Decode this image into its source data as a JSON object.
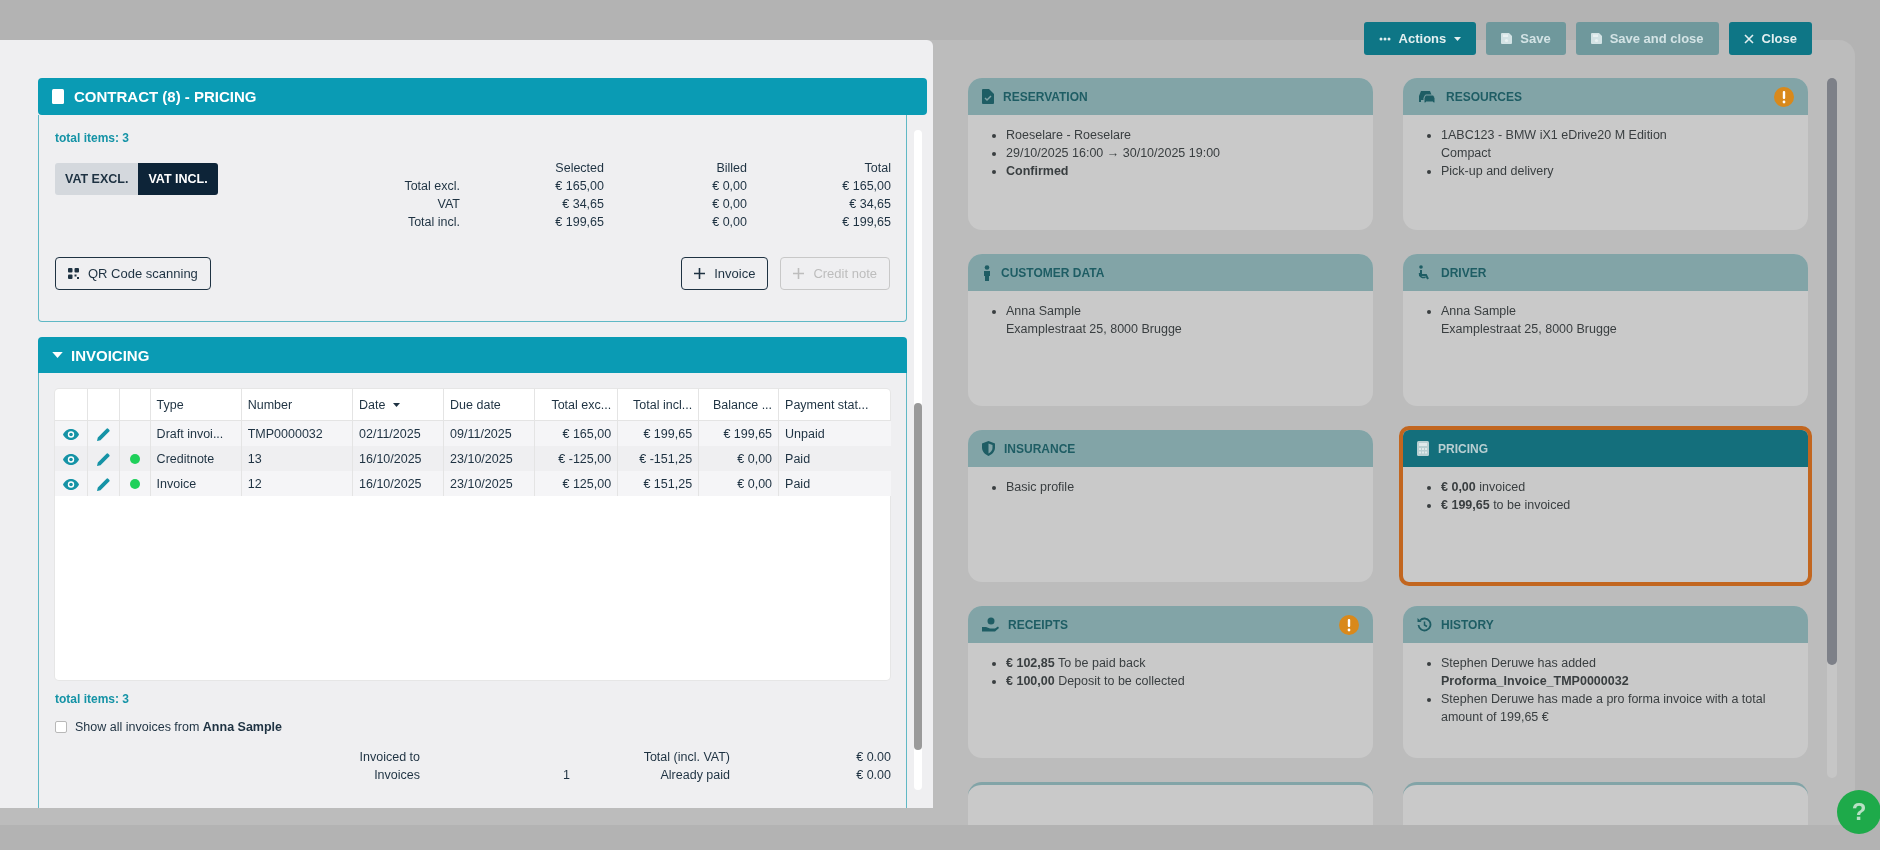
{
  "toolbar": {
    "buttons": [
      {
        "label": "Actions",
        "kind": "menu",
        "disabled": false
      },
      {
        "label": "Save",
        "kind": "save",
        "disabled": true
      },
      {
        "label": "Save and close",
        "kind": "save",
        "disabled": true
      },
      {
        "label": "Close",
        "kind": "close",
        "disabled": false
      }
    ]
  },
  "cards": [
    {
      "title": "RESERVATION",
      "alert": false,
      "highlighted": false,
      "items": [
        "Roeselare - Roeselare",
        "29/10/2025 16:00 → 30/10/2025 19:00",
        "**Confirmed**"
      ]
    },
    {
      "title": "RESOURCES",
      "alert": true,
      "highlighted": false,
      "items": [
        "1ABC123 - BMW iX1 eDrive20 M Edition\nCompact",
        "Pick-up and delivery"
      ]
    },
    {
      "title": "CUSTOMER DATA",
      "alert": false,
      "highlighted": false,
      "items": [
        "Anna Sample\nExamplestraat 25, 8000 Brugge"
      ]
    },
    {
      "title": "DRIVER",
      "alert": false,
      "highlighted": false,
      "items": [
        "Anna Sample\nExamplestraat 25, 8000 Brugge"
      ]
    },
    {
      "title": "INSURANCE",
      "alert": false,
      "highlighted": false,
      "items": [
        "Basic profile"
      ]
    },
    {
      "title": "PRICING",
      "alert": false,
      "highlighted": true,
      "items": [
        "**€ 0,00** invoiced",
        "**€ 199,65** to be invoiced"
      ]
    },
    {
      "title": "RECEIPTS",
      "alert": true,
      "highlighted": false,
      "items": [
        "**€ 102,85** To be paid back",
        "**€ 100,00** Deposit to be collected"
      ]
    },
    {
      "title": "HISTORY",
      "alert": false,
      "highlighted": false,
      "items": [
        "Stephen Deruwe has added\n**Proforma_Invoice_TMP0000032**",
        "Stephen Deruwe has made a pro forma invoice with a total amount of 199,65 €"
      ]
    }
  ],
  "modal": {
    "title": "CONTRACT (8) - PRICING",
    "pricing": {
      "total_items": "total items: 3",
      "vat_toggle": [
        {
          "label": "VAT EXCL.",
          "selected": false
        },
        {
          "label": "VAT INCL.",
          "selected": true
        }
      ],
      "summary": {
        "columns": [
          "Selected",
          "Billed",
          "Total"
        ],
        "rows": [
          {
            "label": "Total excl.",
            "values": [
              "€ 165,00",
              "€ 0,00",
              "€ 165,00"
            ]
          },
          {
            "label": "VAT",
            "values": [
              "€ 34,65",
              "€ 0,00",
              "€ 34,65"
            ]
          },
          {
            "label": "Total incl.",
            "values": [
              "€ 199,65",
              "€ 0,00",
              "€ 199,65"
            ]
          }
        ]
      },
      "buttons": [
        {
          "label": "QR Code scanning",
          "kind": "qr",
          "disabled": false
        },
        {
          "label": "Invoice",
          "kind": "add",
          "disabled": false
        },
        {
          "label": "Credit note",
          "kind": "add",
          "disabled": true
        }
      ]
    },
    "invoicing": {
      "title": "INVOICING",
      "expanded": true,
      "table": {
        "columns": [
          {
            "label": "Type",
            "sorted": false
          },
          {
            "label": "Number",
            "sorted": false
          },
          {
            "label": "Date",
            "sorted": true
          },
          {
            "label": "Due date",
            "sorted": false
          },
          {
            "label": "Total exc...",
            "sorted": false
          },
          {
            "label": "Total incl...",
            "sorted": false
          },
          {
            "label": "Balance ...",
            "sorted": false
          },
          {
            "label": "Payment stat...",
            "sorted": false
          }
        ],
        "rows": [
          {
            "cells": [
              "Draft invoi...",
              "TMP0000032",
              "02/11/2025",
              "09/11/2025",
              "€ 165,00",
              "€ 199,65",
              "€ 199,65",
              "Unpaid"
            ]
          },
          {
            "color": "#1fd05a",
            "cells": [
              "Creditnote",
              "13",
              "16/10/2025",
              "23/10/2025",
              "€ -125,00",
              "€ -151,25",
              "€ 0,00",
              "Paid"
            ]
          },
          {
            "color": "#1fd05a",
            "cells": [
              "Invoice",
              "12",
              "16/10/2025",
              "23/10/2025",
              "€ 125,00",
              "€ 151,25",
              "€ 0,00",
              "Paid"
            ]
          }
        ]
      },
      "total_items": "total items: 3",
      "show_all": {
        "label": "Show all invoices from **Anna Sample**",
        "checked": false
      },
      "summary": [
        {
          "label": "Invoiced to",
          "label2": "Total (incl. VAT)",
          "value2": "€ 0.00"
        },
        {
          "label": "Invoices",
          "value": "1",
          "label2": "Already paid",
          "value2": "€ 0.00"
        }
      ]
    }
  },
  "help": "?"
}
